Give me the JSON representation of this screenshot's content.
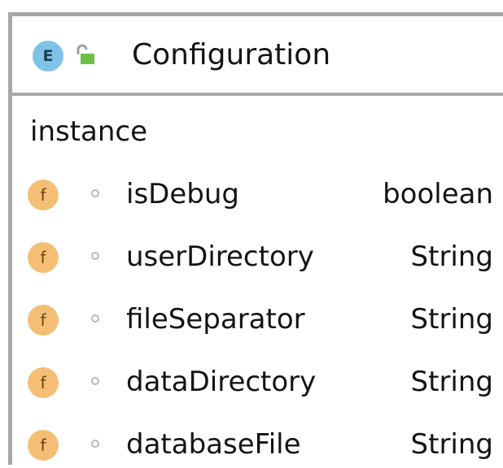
{
  "node": {
    "kind_badge": "E",
    "title": "Configuration",
    "lock_icon": "unlocked-icon",
    "section_label": "instance",
    "field_badge": "f",
    "fields": [
      {
        "name": "isDebug",
        "type": "boolean"
      },
      {
        "name": "userDirectory",
        "type": "String"
      },
      {
        "name": "fileSeparator",
        "type": "String"
      },
      {
        "name": "dataDirectory",
        "type": "String"
      },
      {
        "name": "databaseFile",
        "type": "String"
      }
    ]
  },
  "colors": {
    "border": "#a8a8a8",
    "enum_badge": "#7ec3e6",
    "field_badge": "#f4bf75",
    "lock_green": "#6fbf4a"
  }
}
